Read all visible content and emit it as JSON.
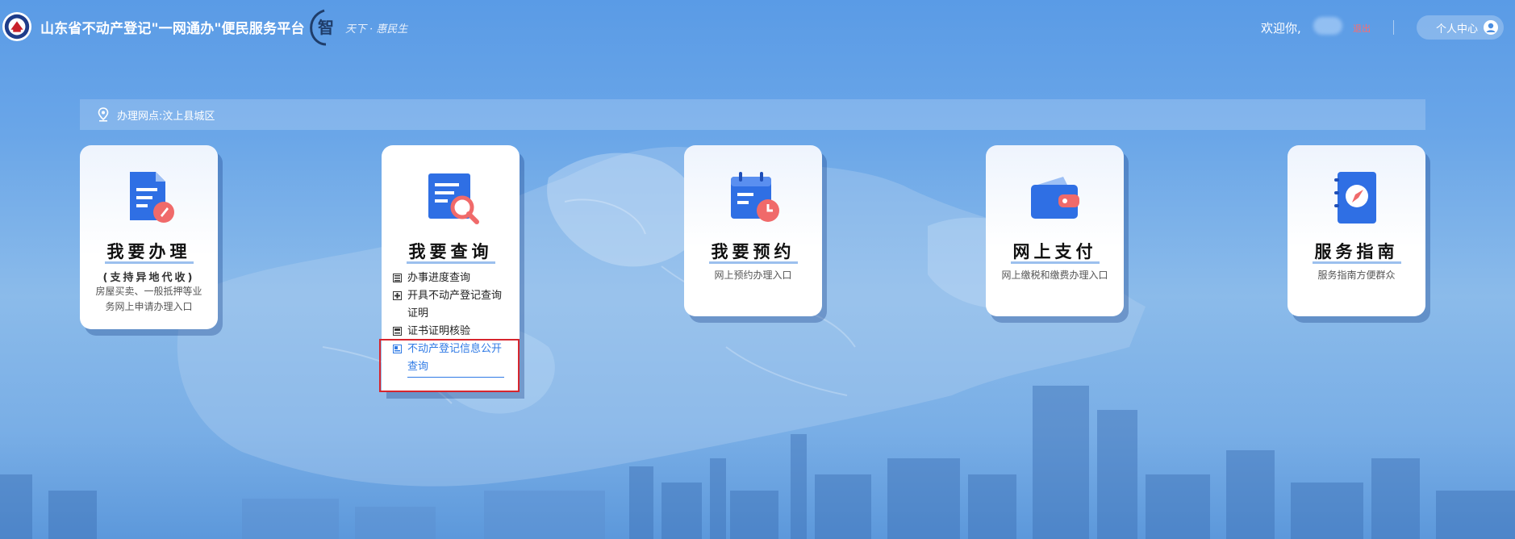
{
  "header": {
    "title": "山东省不动产登记\"一网通办\"便民服务平台",
    "slogan": "天下 · 惠民生",
    "welcome": "欢迎你,",
    "logout": "退出",
    "user_center": "个人中心"
  },
  "location": {
    "label": "办理网点:汶上县城区"
  },
  "cards": [
    {
      "title": "我要办理",
      "subtitle": "(支持异地代收)",
      "desc": "房屋买卖、一般抵押等业务网上申请办理入口",
      "icon": "document-pen-icon"
    },
    {
      "title": "我要查询",
      "icon": "document-search-icon",
      "items": [
        {
          "label": "办事进度查询"
        },
        {
          "label": "开具不动产登记查询证明"
        },
        {
          "label": "证书证明核验"
        },
        {
          "label": "不动产登记信息公开查询"
        }
      ]
    },
    {
      "title": "我要预约",
      "subtitle": "网上预约办理入口",
      "icon": "calendar-clock-icon"
    },
    {
      "title": "网上支付",
      "subtitle": "网上缴税和缴费办理入口",
      "icon": "wallet-icon"
    },
    {
      "title": "服务指南",
      "subtitle": "服务指南方便群众",
      "icon": "compass-book-icon"
    }
  ],
  "colors": {
    "accent": "#2f7ae5",
    "logout": "#ff6b6b",
    "highlight": "#d7262e"
  }
}
